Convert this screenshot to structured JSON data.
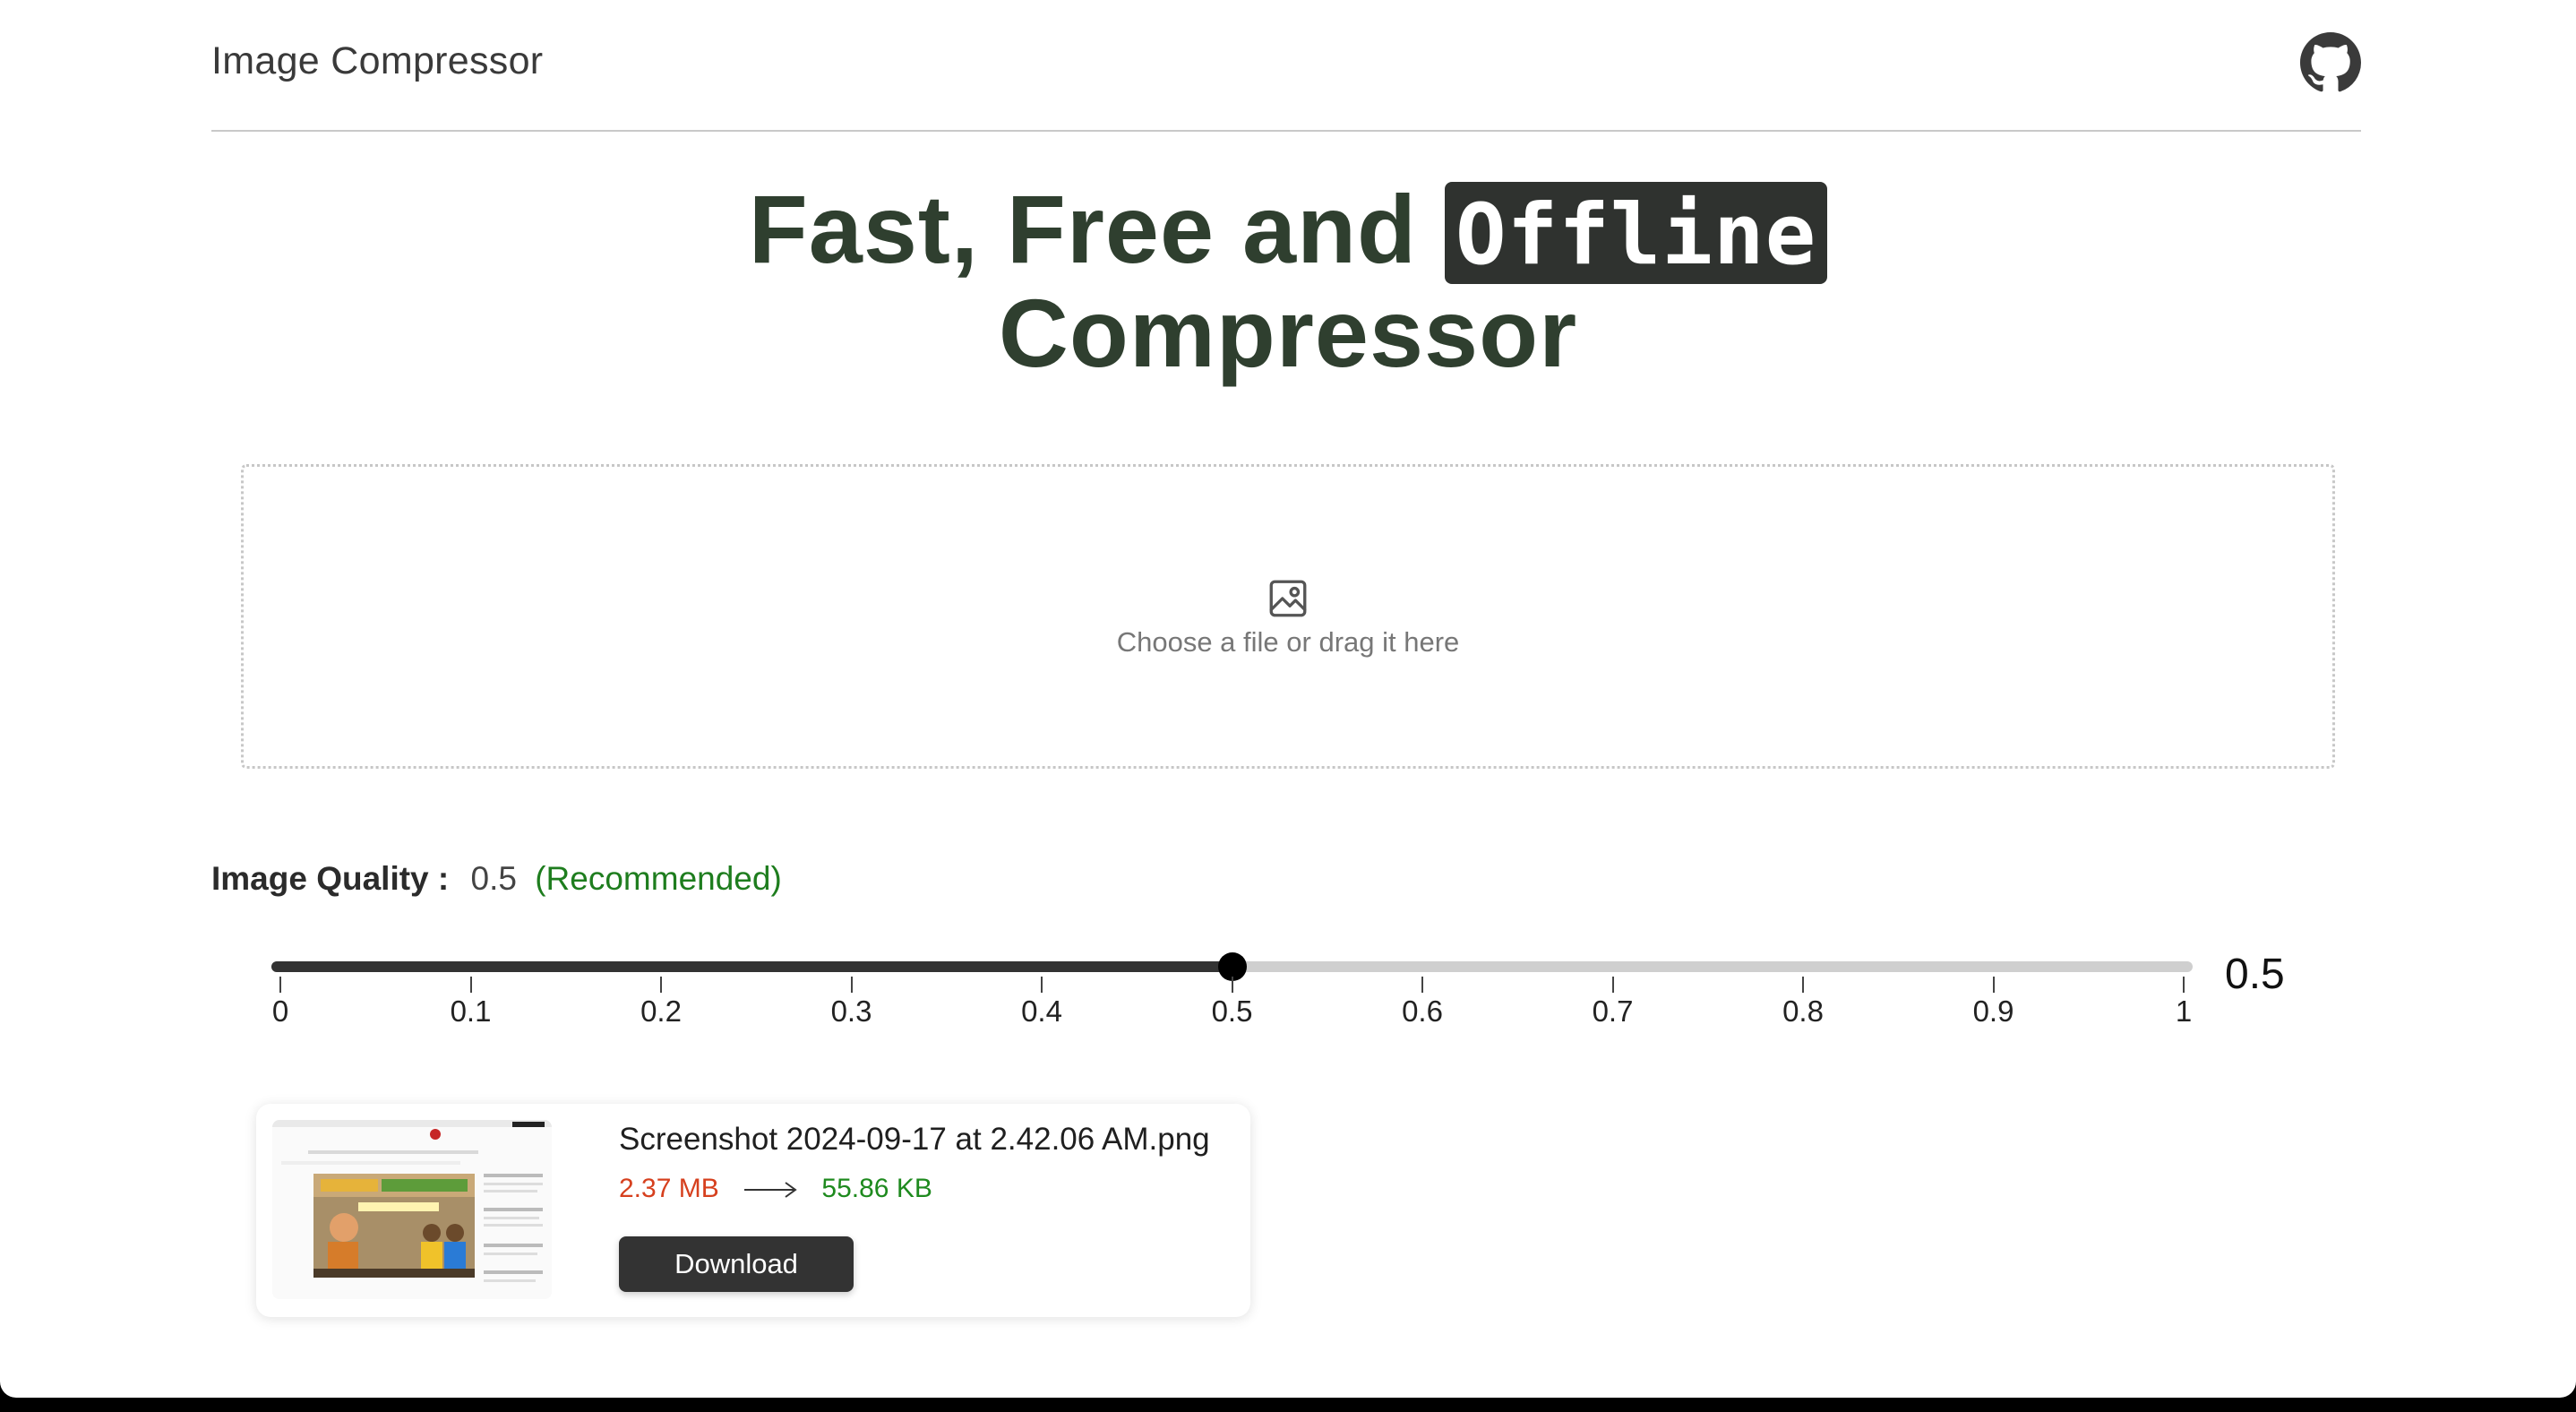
{
  "header": {
    "app_title": "Image Compressor",
    "github_icon": "github-icon"
  },
  "hero": {
    "line1_text": "Fast, Free and",
    "badge_text": "Offline",
    "line2_text": "Compressor",
    "text_color": "#2f3f2f",
    "badge_color": "#2f322f"
  },
  "dropzone": {
    "icon": "image-icon",
    "text": "Choose a file or drag it here"
  },
  "quality": {
    "label": "Image Quality :",
    "value": "0.5",
    "recommendation": "(Recommended)",
    "recommendation_color": "#1e7d1e"
  },
  "slider": {
    "min": 0,
    "max": 1,
    "value": 0.5,
    "readout": "0.5",
    "ticks": [
      "0",
      "0.1",
      "0.2",
      "0.3",
      "0.4",
      "0.5",
      "0.6",
      "0.7",
      "0.8",
      "0.9",
      "1"
    ]
  },
  "result": {
    "file_name": "Screenshot 2024-09-17 at 2.42.06 AM.png",
    "original_size": "2.37 MB",
    "compressed_size": "55.86 KB",
    "arrow_icon": "arrow-right-icon",
    "download_label": "Download",
    "original_color": "#d6401e",
    "compressed_color": "#1e8a1e"
  }
}
